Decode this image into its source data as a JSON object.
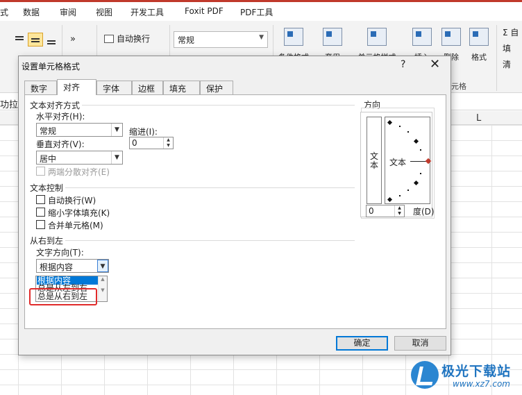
{
  "menubar": {
    "items": [
      "式",
      "数据",
      "审阅",
      "视图",
      "开发工具",
      "Foxit PDF",
      "PDF工具"
    ]
  },
  "ribbon": {
    "wrap_text_label": "自动换行",
    "number_format_value": "常规",
    "conditional_format_label": "条件格式",
    "table_style_label": "套用",
    "cell_style_label": "单元格样式",
    "insert_label": "插入",
    "delete_label": "删除",
    "format_label": "格式",
    "group_cells_label": "元格",
    "right_items": [
      "Σ 自",
      "填",
      "清"
    ],
    "left_cut": "功拉"
  },
  "sheet": {
    "col_header_L": "L"
  },
  "dialog": {
    "title": "设置单元格格式",
    "help": "?",
    "close": "✕",
    "tabs": [
      "数字",
      "对齐",
      "字体",
      "边框",
      "填充",
      "保护"
    ],
    "active_tab": 1,
    "text_align_section": "文本对齐方式",
    "horizontal_label": "水平对齐(H):",
    "horizontal_value": "常规",
    "indent_label": "缩进(I):",
    "indent_value": "0",
    "vertical_label": "垂直对齐(V):",
    "vertical_value": "居中",
    "distributed_label": "两端分散对齐(E)",
    "text_control_section": "文本控制",
    "wrap_label": "自动换行(W)",
    "shrink_label": "缩小字体填充(K)",
    "merge_label": "合并单元格(M)",
    "rtl_section": "从右到左",
    "text_direction_label": "文字方向(T):",
    "text_direction_value": "根据内容",
    "text_direction_options": [
      "根据内容",
      "总是从左到右",
      "总是从右到左"
    ],
    "orientation_section": "方向",
    "orientation_vertical_text": "文本",
    "orientation_dial_text": "文本",
    "degrees_value": "0",
    "degrees_label": "度(D)",
    "ok_label": "确定",
    "cancel_label": "取消"
  },
  "watermark": {
    "name": "极光下载站",
    "url": "www.xz7.com"
  }
}
